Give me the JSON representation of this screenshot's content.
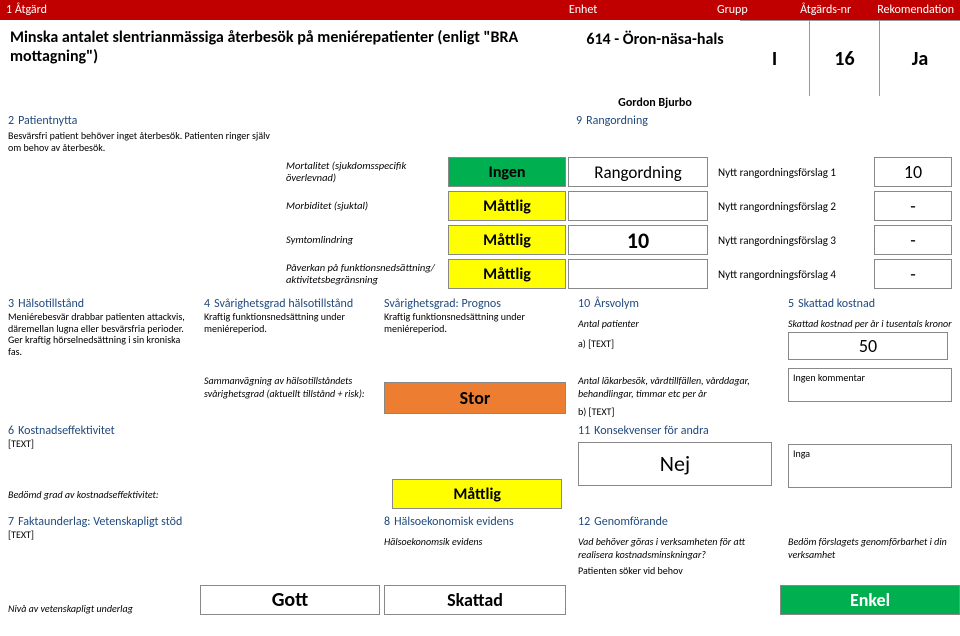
{
  "topbar": {
    "n": "1",
    "atgard": "Åtgärd",
    "enhet": "Enhet",
    "grupp": "Grupp",
    "nr": "Åtgärds-nr",
    "rek": "Rekomendation"
  },
  "title": "Minska antalet slentrianmässiga återbesök på meniérepatienter (enligt \"BRA mottagning\")",
  "clinic": "614 - Öron-näsa-hals",
  "group": "I",
  "actionNr": "16",
  "recommendation": "Ja",
  "gordon": "Gordon Bjurbo",
  "s2": {
    "head": "Patientnytta",
    "num": "2",
    "desc": "Besvärsfri patient behöver inget återbesök. Patienten ringer själv om behov av återbesök."
  },
  "s9": {
    "head": "Rangordning",
    "num": "9"
  },
  "rank": {
    "r1": {
      "label": "Mortalitet (sjukdomsspecifik överlevnad)",
      "pill": "Ingen",
      "main": "Rangordning",
      "text": "Nytt rangordningsförslag 1",
      "val": "10"
    },
    "r2": {
      "label": "Morbiditet (sjuktal)",
      "pill": "Måttlig",
      "text": "Nytt rangordningsförslag 2",
      "val": "-"
    },
    "r3": {
      "label": "Symtomlindring",
      "pill": "Måttlig",
      "main": "10",
      "text": "Nytt rangordningsförslag 3",
      "val": "-"
    },
    "r4": {
      "label": "Påverkan på funktionsnedsättning/ aktivitetsbegränsning",
      "pill": "Måttlig",
      "text": "Nytt rangordningsförslag 4",
      "val": "-"
    }
  },
  "s3": {
    "num": "3",
    "head": "Hälsotillstånd",
    "body": "Meniérebesvär drabbar patienten attackvis, däremellan lugna eller besvärsfria perioder. Ger kraftig hörselnedsättning i sin kroniska fas."
  },
  "s4": {
    "num": "4",
    "head": "Svårighetsgrad hälsotillstånd",
    "body": "Kraftig funktionsnedsättning under meniéreperiod."
  },
  "prognos": {
    "head": "Svårighetsgrad: Prognos",
    "body": "Kraftig funktionsnedsättning under meniéreperiod."
  },
  "s10": {
    "num": "10",
    "head": "Årsvolym",
    "sub1": "Antal patienter",
    "sub2": "a) [TEXT]"
  },
  "s5": {
    "num": "5",
    "head": "Skattad kostnad",
    "sub": "Skattad kostnad per år i tusentals kronor",
    "val": "50"
  },
  "mid": {
    "samman": "Sammanvägning av hälsotillståndets svårighetsgrad (aktuellt tillstånd + risk):",
    "stor": "Stor",
    "lakare": "Antal läkarbesök, vårdtillfällen, vårddagar, behandlingar, timmar etc per år",
    "btxt": "b) [TEXT]",
    "nocomment": "Ingen kommentar"
  },
  "s6": {
    "num": "6",
    "head": "Kostnadseffektivitet",
    "body": "[TEXT]",
    "sub": "Bedömd grad av kostnadseffektivitet:",
    "pill": "Måttlig"
  },
  "s11": {
    "num": "11",
    "head": "Konsekvenser för andra",
    "val": "Nej",
    "inga": "Inga"
  },
  "s7": {
    "num": "7",
    "head": "Faktaunderlag: Vetenskapligt stöd",
    "body": "[TEXT]",
    "sub": "Nivå av vetenskapligt underlag",
    "pill": "Gott"
  },
  "s8": {
    "num": "8",
    "head": "Hälsoekonomisk evidens",
    "sub": "Hälsoekonomsik evidens",
    "pill": "Skattad"
  },
  "s12": {
    "num": "12",
    "head": "Genomförande",
    "q": "Vad behöver göras i verksamheten för att realisera kostnadsminskningar?",
    "a": "Patienten söker vid behov",
    "right": "Bedöm förslagets genomförbarhet i din verksamhet",
    "pill": "Enkel"
  }
}
